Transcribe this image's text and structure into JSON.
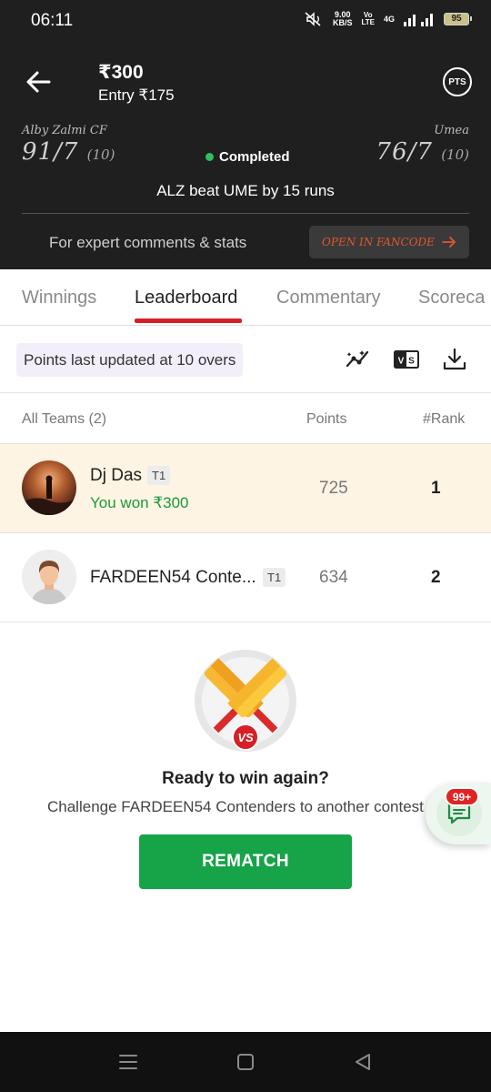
{
  "status_bar": {
    "time": "06:11",
    "speed_value": "9.00",
    "speed_unit": "KB/S",
    "volte_top": "Vo",
    "volte_bottom": "LTE",
    "network": "4G",
    "battery": "95"
  },
  "header": {
    "prize": "₹300",
    "entry": "Entry ₹175",
    "pts_label": "PTS",
    "team_a": {
      "name": "Alby Zalmi CF",
      "score": "91/7",
      "overs": "(10)"
    },
    "team_b": {
      "name": "Umea",
      "score": "76/7",
      "overs": "(10)"
    },
    "status": "Completed",
    "result": "ALZ beat UME by 15 runs",
    "expert_text": "For expert comments & stats",
    "fancode_label": "OPEN IN FANCODE"
  },
  "tabs": [
    {
      "label": "Winnings"
    },
    {
      "label": "Leaderboard"
    },
    {
      "label": "Commentary"
    },
    {
      "label": "Scoreca"
    }
  ],
  "toolbar": {
    "points_updated": "Points last updated at 10 overs",
    "compare_label": "VS"
  },
  "table": {
    "headers": {
      "teams": "All Teams (2)",
      "points": "Points",
      "rank": "#Rank"
    },
    "rows": [
      {
        "name": "Dj Das",
        "team": "T1",
        "subtitle": "You won ₹300",
        "points": "725",
        "rank": "1"
      },
      {
        "name": "FARDEEN54 Conte...",
        "team": "T1",
        "subtitle": "",
        "points": "634",
        "rank": "2"
      }
    ]
  },
  "promo": {
    "vs_label": "VS",
    "title": "Ready to win again?",
    "subtitle": "Challenge FARDEEN54 Contenders to another contest",
    "button": "REMATCH"
  },
  "chat": {
    "badge": "99+"
  },
  "colors": {
    "header_bg": "#1f1f1f",
    "accent_red": "#d61f26",
    "success_green": "#17a348",
    "winner_row": "#fdf4e3",
    "pill_bg": "#f3effa"
  }
}
